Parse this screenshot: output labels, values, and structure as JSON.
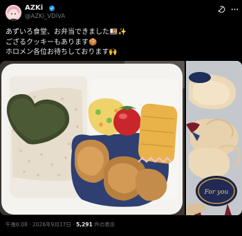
{
  "author": {
    "display_name": "AZKi",
    "handle": "@AZKi_VDiVA"
  },
  "post": {
    "lines": [
      "あずいろ食堂、お弁当できました🍱✨",
      "ござるクッキーもあります🍪",
      "ホロメン各位お待ちしております🙌"
    ]
  },
  "media": {
    "photos": [
      {
        "subject": "bento-box-photo"
      },
      {
        "subject": "cookies-photo",
        "card_text": "For you"
      }
    ]
  },
  "meta": {
    "time": "午後6:08",
    "separator": "·",
    "date": "2026年9月17日",
    "views_count": "5,291",
    "views_suffix": "件の表示"
  },
  "colors": {
    "background": "#000000",
    "text": "#e7e9ea",
    "muted": "#71767b",
    "verified": "#1d9bf0"
  },
  "icons": [
    "verified-badge-icon",
    "grok-icon",
    "more-options-icon"
  ]
}
